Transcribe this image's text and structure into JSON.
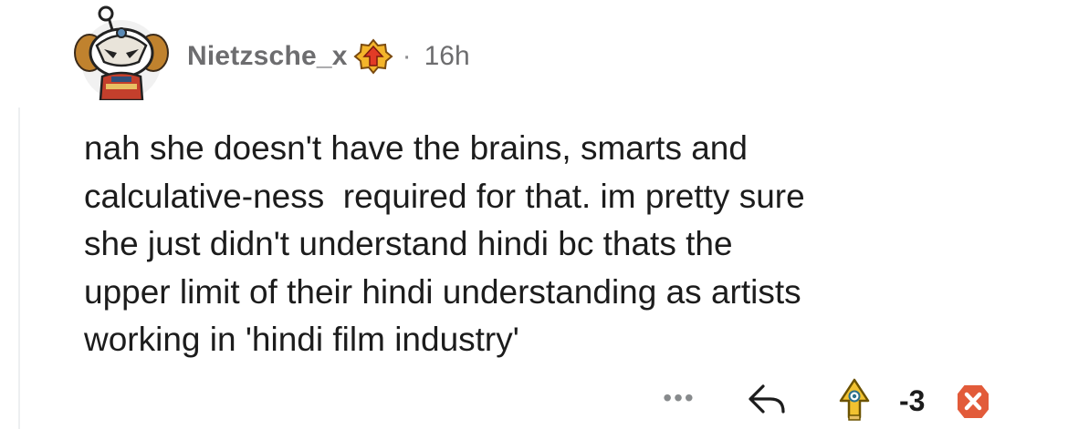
{
  "comment": {
    "author": "Nietzsche_x",
    "separator": "·",
    "timestamp": "16h",
    "body": "nah she doesn't have the brains, smarts and\ncalculative-ness  required for that. im pretty sure\nshe just didn't understand hindi bc thats the\nupper limit of their hindi understanding as artists\nworking in 'hindi film industry'",
    "score": "-3"
  },
  "actions": {
    "more_label": "•••",
    "icons": {
      "avatar": "snoo-avatar-icon",
      "badge": "achievement-badge-icon",
      "more": "more-options-icon",
      "reply": "reply-arrow-icon",
      "upvote": "upvote-icon",
      "downvote": "downvote-icon"
    }
  },
  "colors": {
    "username": "#6d6d6f",
    "meta": "#6d6d6f",
    "body": "#1c1c1c",
    "downvote": "#e25b3a",
    "upvote_gold": "#f2c230",
    "thread_line": "#edeff1"
  }
}
